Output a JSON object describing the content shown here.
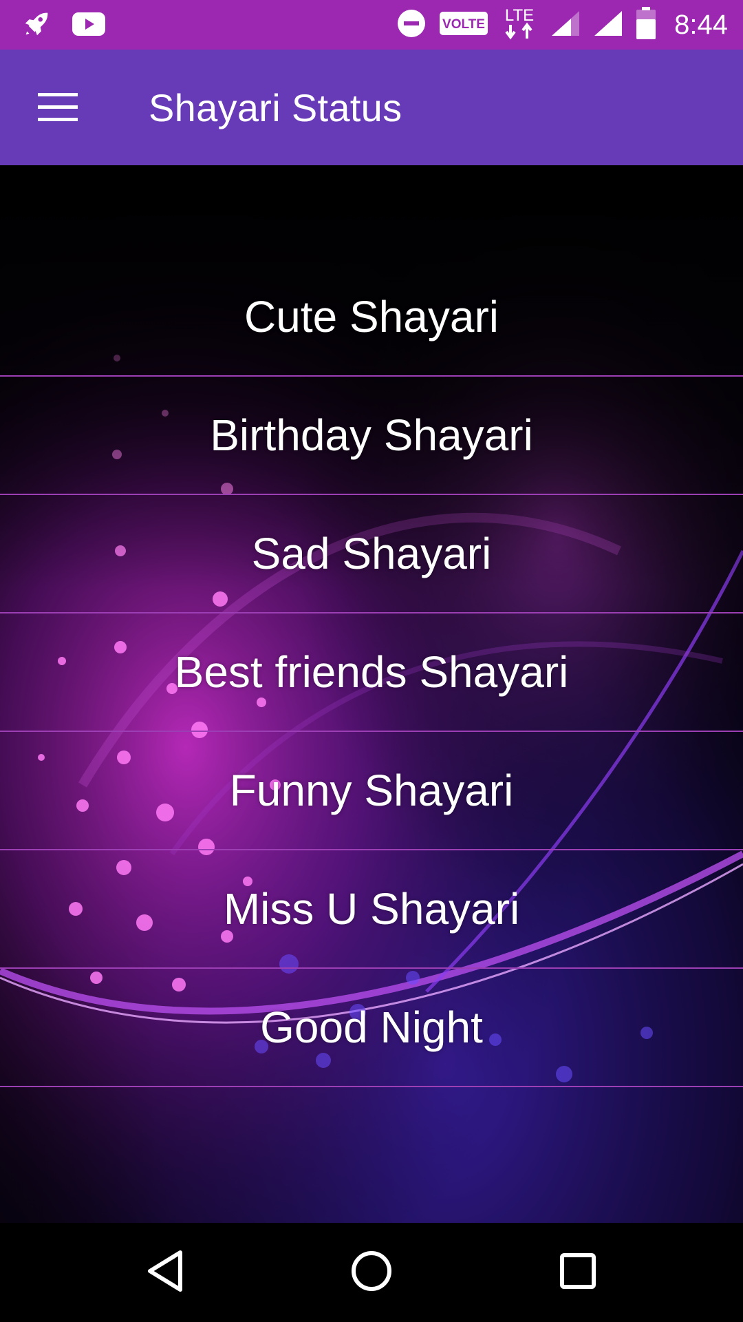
{
  "status_bar": {
    "time": "8:44",
    "network_label": "LTE",
    "volte_label": "VOLTE",
    "icons": [
      "rocket-icon",
      "youtube-icon",
      "do-not-disturb-icon",
      "volte-icon",
      "lte-icon",
      "signal-icon",
      "signal-icon",
      "battery-icon"
    ]
  },
  "app_bar": {
    "title": "Shayari Status",
    "menu_icon": "hamburger-menu-icon"
  },
  "list": {
    "items": [
      "Cute Shayari",
      "Birthday Shayari",
      "Sad Shayari",
      "Best friends Shayari",
      "Funny Shayari",
      "Miss U Shayari",
      "Good Night"
    ]
  },
  "nav_bar": {
    "icons": [
      "back-icon",
      "home-icon",
      "recents-icon"
    ]
  },
  "colors": {
    "status_bar": "#9c27b0",
    "app_bar": "#673ab7",
    "divider": "#9c3fb4",
    "text": "#ffffff"
  }
}
